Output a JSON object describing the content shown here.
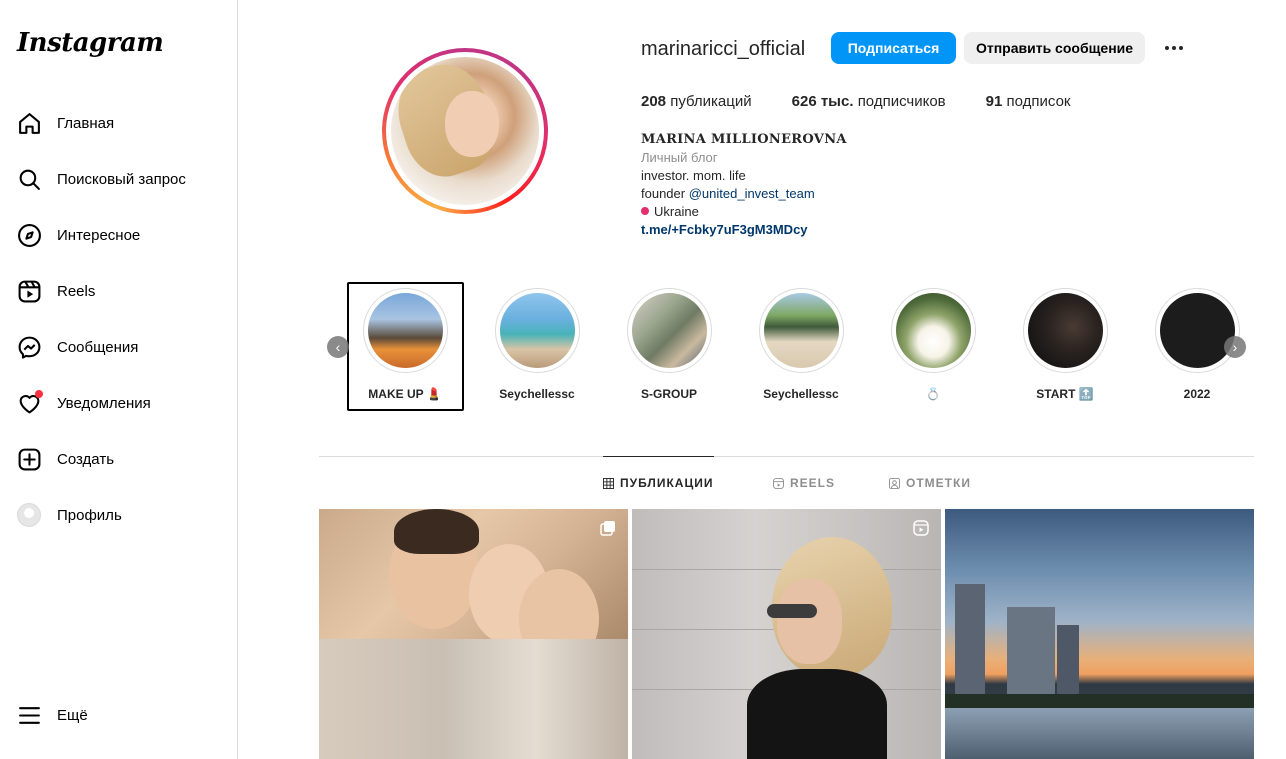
{
  "app": {
    "logo_text": "Instagram"
  },
  "sidebar": {
    "items": [
      {
        "label": "Главная",
        "icon": "home-icon"
      },
      {
        "label": "Поисковый запрос",
        "icon": "search-icon"
      },
      {
        "label": "Интересное",
        "icon": "compass-icon"
      },
      {
        "label": "Reels",
        "icon": "reels-icon"
      },
      {
        "label": "Сообщения",
        "icon": "messenger-icon"
      },
      {
        "label": "Уведомления",
        "icon": "heart-icon"
      },
      {
        "label": "Создать",
        "icon": "plus-square-icon"
      },
      {
        "label": "Профиль",
        "icon": "avatar"
      }
    ],
    "more_label": "Ещё"
  },
  "profile": {
    "username": "marinaricci_official",
    "follow_label": "Подписаться",
    "message_label": "Отправить сообщение",
    "stats": {
      "posts_count": "208",
      "posts_label": "публикаций",
      "followers_count": "626 тыс.",
      "followers_label": "подписчиков",
      "following_count": "91",
      "following_label": "подписок"
    },
    "bio": {
      "full_name": "MARINA MILLIONEROVNA",
      "category": "Личный блог",
      "line1": "investor. mom. life",
      "line2_prefix": "founder",
      "mention": "@united_invest_team",
      "location": "Ukraine",
      "link": "t.me/+Fcbky7uF3gM3MDcy"
    }
  },
  "highlights": [
    {
      "label": "MAKE UP 💄"
    },
    {
      "label": "Seychellessc"
    },
    {
      "label": "S-GROUP"
    },
    {
      "label": "Seychellessc"
    },
    {
      "label": "💍"
    },
    {
      "label": "START 🔝"
    },
    {
      "label": "2022"
    }
  ],
  "tabs": [
    {
      "label": "ПУБЛИКАЦИИ",
      "active": true
    },
    {
      "label": "REELS",
      "active": false
    },
    {
      "label": "ОТМЕТКИ",
      "active": false
    }
  ],
  "colors": {
    "accent": "#0095f6",
    "link": "#00376b",
    "notification": "#ff3040"
  }
}
